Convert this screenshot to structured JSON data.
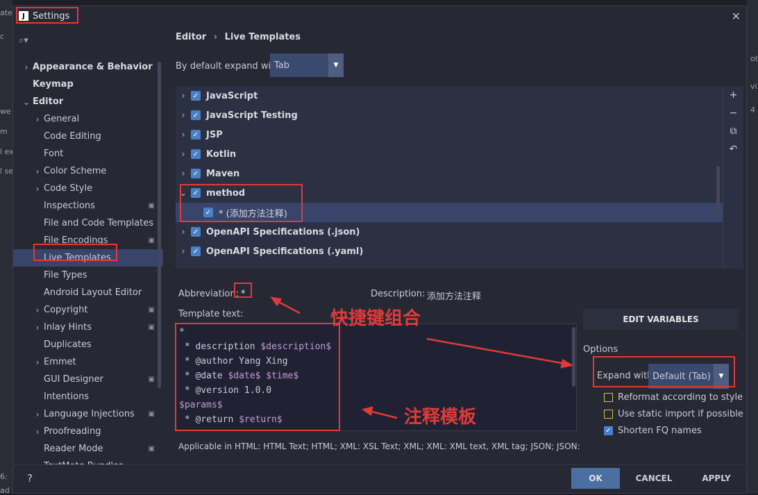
{
  "window": {
    "title": "Settings",
    "app_icon": "J"
  },
  "background": {
    "left_fragments": [
      "ate",
      "c",
      "we",
      "m",
      "l ex",
      "l se",
      "6:",
      "ad"
    ],
    "right_fragments": [
      "ot",
      "vi",
      "4"
    ]
  },
  "sidebar": {
    "items": [
      {
        "label": "Appearance & Behavior",
        "level": 0,
        "arrow": "›",
        "bold": true
      },
      {
        "label": "Keymap",
        "level": 0,
        "arrow": "",
        "bold": true
      },
      {
        "label": "Editor",
        "level": 0,
        "arrow": "⌄",
        "bold": true
      },
      {
        "label": "General",
        "level": 1,
        "arrow": "›"
      },
      {
        "label": "Code Editing",
        "level": 1,
        "arrow": ""
      },
      {
        "label": "Font",
        "level": 1,
        "arrow": ""
      },
      {
        "label": "Color Scheme",
        "level": 1,
        "arrow": "›"
      },
      {
        "label": "Code Style",
        "level": 1,
        "arrow": "›"
      },
      {
        "label": "Inspections",
        "level": 1,
        "arrow": "",
        "badge": true
      },
      {
        "label": "File and Code Templates",
        "level": 1,
        "arrow": ""
      },
      {
        "label": "File Encodings",
        "level": 1,
        "arrow": "",
        "badge": true
      },
      {
        "label": "Live Templates",
        "level": 1,
        "arrow": "",
        "selected": true
      },
      {
        "label": "File Types",
        "level": 1,
        "arrow": ""
      },
      {
        "label": "Android Layout Editor",
        "level": 1,
        "arrow": ""
      },
      {
        "label": "Copyright",
        "level": 1,
        "arrow": "›",
        "badge": true
      },
      {
        "label": "Inlay Hints",
        "level": 1,
        "arrow": "›",
        "badge": true
      },
      {
        "label": "Duplicates",
        "level": 1,
        "arrow": ""
      },
      {
        "label": "Emmet",
        "level": 1,
        "arrow": "›"
      },
      {
        "label": "GUI Designer",
        "level": 1,
        "arrow": "",
        "badge": true
      },
      {
        "label": "Intentions",
        "level": 1,
        "arrow": ""
      },
      {
        "label": "Language Injections",
        "level": 1,
        "arrow": "›",
        "badge": true
      },
      {
        "label": "Proofreading",
        "level": 1,
        "arrow": "›"
      },
      {
        "label": "Reader Mode",
        "level": 1,
        "arrow": "",
        "badge": true
      },
      {
        "label": "TextMate Bundles",
        "level": 1,
        "arrow": ""
      }
    ]
  },
  "breadcrumb": {
    "part1": "Editor",
    "sep": "›",
    "part2": "Live Templates"
  },
  "expand_default": {
    "label": "By default expand with",
    "value": "Tab"
  },
  "template_groups": [
    {
      "label": "JavaScript",
      "expanded": false
    },
    {
      "label": "JavaScript Testing",
      "expanded": false
    },
    {
      "label": "JSP",
      "expanded": false
    },
    {
      "label": "Kotlin",
      "expanded": false
    },
    {
      "label": "Maven",
      "expanded": false
    },
    {
      "label": "method",
      "expanded": true
    },
    {
      "label": "* (添加方法注释)",
      "child": true
    },
    {
      "label": "OpenAPI Specifications (.json)",
      "expanded": false
    },
    {
      "label": "OpenAPI Specifications (.yaml)",
      "expanded": false
    }
  ],
  "tools": [
    "+",
    "−",
    "⧉",
    "↶"
  ],
  "abbreviation": {
    "label": "Abbreviation:",
    "value": "*"
  },
  "description": {
    "label": "Description:",
    "value": "添加方法注释"
  },
  "template_text": {
    "label": "Template text:",
    "lines": [
      [
        {
          "t": "*"
        }
      ],
      [
        {
          "t": " * description "
        },
        {
          "t": "$description$",
          "v": true
        }
      ],
      [
        {
          "t": " * @author Yang Xing"
        }
      ],
      [
        {
          "t": " * @date "
        },
        {
          "t": "$date$",
          "v": true
        },
        {
          "t": " "
        },
        {
          "t": "$time$",
          "v": true
        }
      ],
      [
        {
          "t": " * @version 1.0.0"
        }
      ],
      [
        {
          "t": "$params$",
          "v": true
        }
      ],
      [
        {
          "t": " * @return "
        },
        {
          "t": "$return$",
          "v": true
        }
      ]
    ]
  },
  "applicable": "Applicable in HTML: HTML Text; HTML; XML: XSL Text; XML; XML: XML text, XML tag; JSON; JSON:",
  "edit_variables": "EDIT VARIABLES",
  "options": {
    "label": "Options",
    "expand_with_label": "Expand with",
    "expand_with_value": "Default (Tab)",
    "checks": [
      {
        "label": "Reformat according to style",
        "checked": false
      },
      {
        "label": "Use static import if possible",
        "checked": false
      },
      {
        "label": "Shorten FQ names",
        "checked": true
      }
    ]
  },
  "footer": {
    "help": "?",
    "ok": "OK",
    "cancel": "CANCEL",
    "apply": "APPLY"
  },
  "annotations": {
    "shortcut": "快捷键组合",
    "template": "注释模板"
  },
  "colors": {
    "annotation": "#e03a3a",
    "selection": "#39446a",
    "accent": "#4a80c8"
  }
}
